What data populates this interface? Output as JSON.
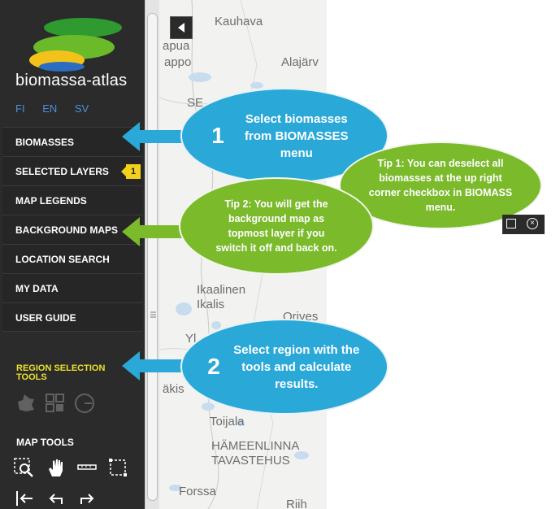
{
  "app": {
    "brand": "biomassa-atlas"
  },
  "languages": [
    "FI",
    "EN",
    "SV"
  ],
  "menu": [
    {
      "label": "BIOMASSES"
    },
    {
      "label": "SELECTED LAYERS",
      "badge": "1"
    },
    {
      "label": "MAP LEGENDS"
    },
    {
      "label": "BACKGROUND MAPS"
    },
    {
      "label": "LOCATION SEARCH"
    },
    {
      "label": "MY DATA"
    },
    {
      "label": "USER GUIDE"
    }
  ],
  "region_tools": {
    "title": "REGION SELECTION TOOLS",
    "icons": [
      "polygon-select-icon",
      "grid-select-icon",
      "circle-select-icon"
    ]
  },
  "map_tools": {
    "title": "MAP TOOLS",
    "icons": [
      "zoom-box-icon",
      "pan-hand-icon",
      "measure-ruler-icon",
      "measure-area-icon",
      "full-extent-icon",
      "undo-icon",
      "redo-icon"
    ]
  },
  "map": {
    "places": [
      "Kauhava",
      "apua",
      "appo",
      "Alajärv",
      "SE",
      "Ikaalinen",
      "Ikalis",
      "Orives",
      "Yl",
      "äkis",
      "Toijala",
      "HÄMEENLINNA",
      "TAVASTEHUS",
      "Forssa",
      "Riih"
    ]
  },
  "callouts": {
    "step1": {
      "number": "1",
      "text": "Select biomasses from BIOMASSES menu"
    },
    "step2": {
      "number": "2",
      "text": "Select region with the tools and calculate results."
    },
    "tip1": {
      "text": "Tip 1: You can deselect all biomasses at the up right corner checkbox in BIOMASS menu."
    },
    "tip2": {
      "text": "Tip 2: You will get the background map as topmost layer if you switch it off and back on."
    }
  },
  "colors": {
    "sidebar": "#2b2b2b",
    "blue_callout": "#2aa8d8",
    "green_callout": "#7aba2b",
    "accent_yellow": "#e9e12e",
    "lang_link": "#4e8fd8"
  }
}
